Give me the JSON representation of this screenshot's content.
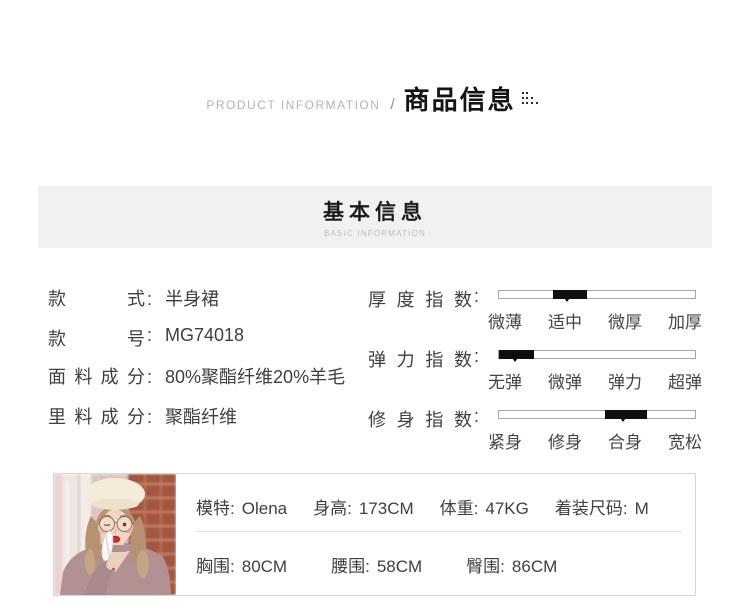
{
  "colon": ":",
  "header": {
    "en": "PRODUCT INFORMATION",
    "slash": "/",
    "zh": "商品信息"
  },
  "section": {
    "title": "基本信息",
    "subtitle": "BASIC INFORMATION"
  },
  "specs": [
    {
      "label": "款式",
      "value": "半身裙"
    },
    {
      "label": "款号",
      "value": "MG74018"
    },
    {
      "label": "面料成分",
      "value": "80%聚酯纤维20%羊毛"
    },
    {
      "label": "里料成分",
      "value": "聚酯纤维"
    }
  ],
  "indicators": [
    {
      "label": "厚度指数",
      "options": [
        "微薄",
        "适中",
        "微厚",
        "加厚"
      ],
      "selected": "适中",
      "segment": {
        "left_pct": 27.3,
        "width_pct": 17.7
      },
      "pointer_pct": 34.8
    },
    {
      "label": "弹力指数",
      "options": [
        "无弹",
        "微弹",
        "弹力",
        "超弹"
      ],
      "selected": "无弹",
      "segment": {
        "left_pct": 0,
        "width_pct": 17.7
      },
      "pointer_pct": 8.5
    },
    {
      "label": "修身指数",
      "options": [
        "紧身",
        "修身",
        "合身",
        "宽松"
      ],
      "selected": "合身",
      "segment": {
        "left_pct": 54.0,
        "width_pct": 21.7
      },
      "pointer_pct": 63.0
    }
  ],
  "model": {
    "photo_alt": "model-photo",
    "row1": [
      {
        "label": "模特:",
        "value": "Olena"
      },
      {
        "label": "身高:",
        "value": "173CM"
      },
      {
        "label": "体重:",
        "value": "47KG"
      },
      {
        "label": "着装尺码:",
        "value": "M"
      }
    ],
    "row2": [
      {
        "label": "胸围:",
        "value": "80CM"
      },
      {
        "label": "腰围:",
        "value": "58CM"
      },
      {
        "label": "臀围:",
        "value": "86CM"
      }
    ]
  },
  "colors": {
    "band_bg": "#f1f1f1",
    "segment_black": "#0e0e0e",
    "text_main": "#3f3f3f",
    "text_muted": "#b3b3b3",
    "card_border": "#d5d5d5"
  }
}
